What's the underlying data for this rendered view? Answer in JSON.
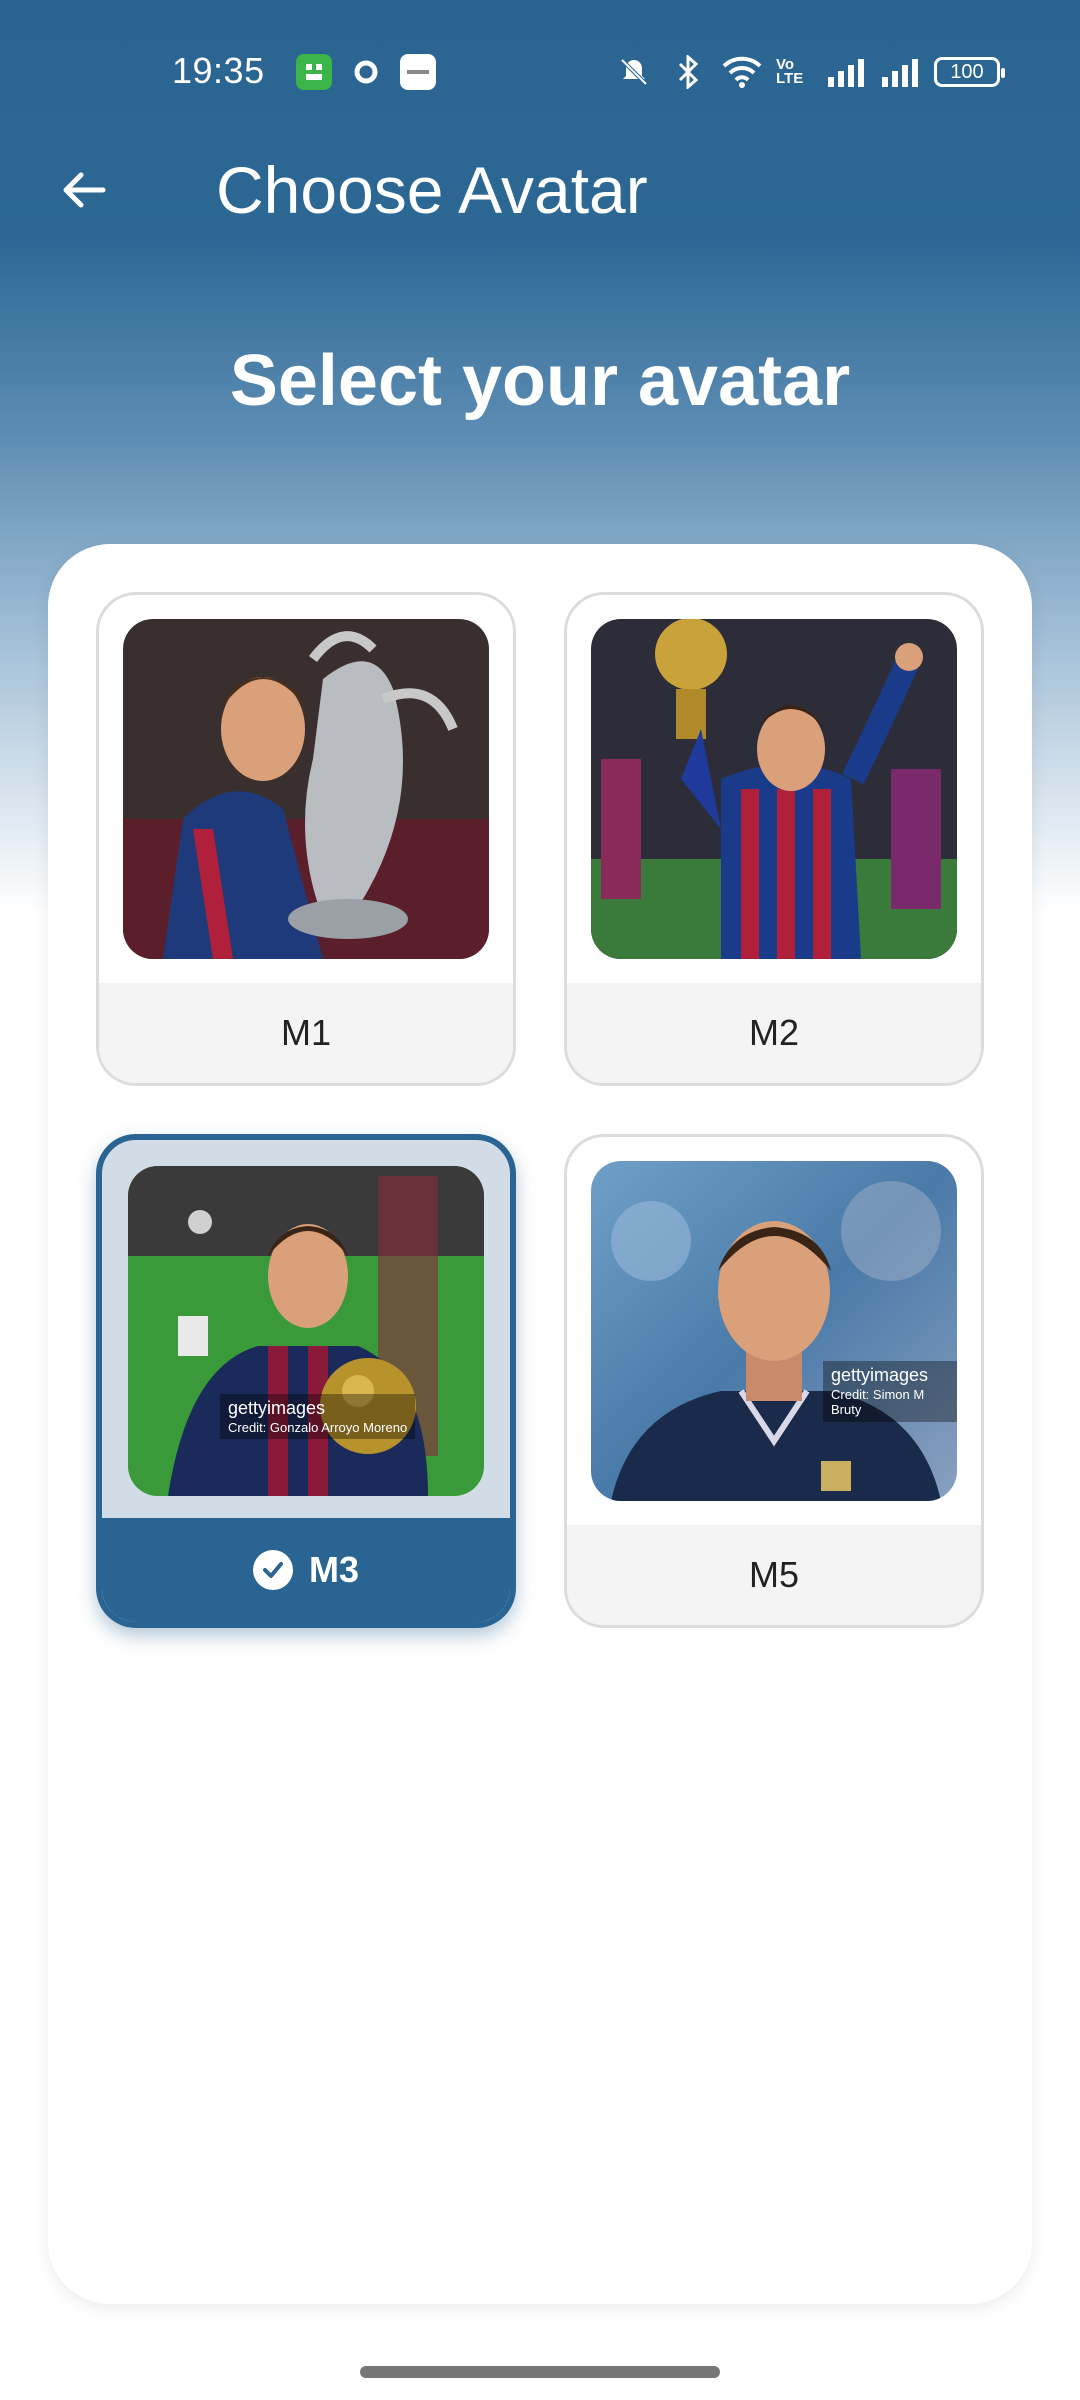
{
  "status_bar": {
    "time": "19:35",
    "app_badges": [
      "app-green-icon",
      "circle-o-icon",
      "notification-card-icon"
    ],
    "icons": [
      "mute-bell-icon",
      "bluetooth-icon",
      "wifi-icon",
      "volte-icon",
      "signal-icon",
      "signal-icon"
    ],
    "volte_text": "Vo LTE",
    "battery": "100"
  },
  "app_bar": {
    "title": "Choose Avatar"
  },
  "heading": "Select your avatar",
  "avatars": [
    {
      "label": "M1",
      "selected": false
    },
    {
      "label": "M2",
      "selected": false
    },
    {
      "label": "M3",
      "selected": true
    },
    {
      "label": "M5",
      "selected": false
    }
  ],
  "watermarks": {
    "m3_brand": "gettyimages",
    "m3_credit": "Credit: Gonzalo Arroyo Moreno",
    "m5_brand": "gettyimages",
    "m5_credit": "Credit: Simon M Bruty"
  },
  "colors": {
    "primary": "#2a6492",
    "card_bg": "#ffffff",
    "label_bg": "#f4f4f4"
  }
}
